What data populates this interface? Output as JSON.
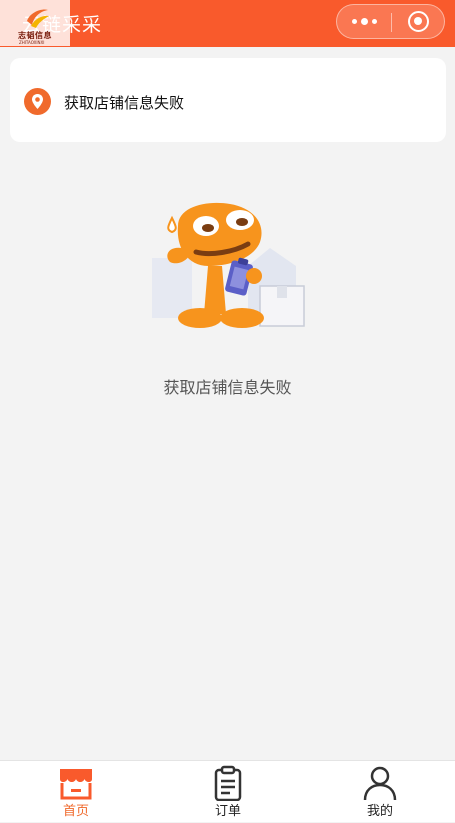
{
  "header": {
    "title": "云链采采",
    "logo_cn": "志韬信息",
    "logo_en": "ZHITAOXINXI",
    "more_icon": "more-dots-icon",
    "close_icon": "target-close-icon"
  },
  "store": {
    "icon": "location-pin-icon",
    "status_text": "获取店铺信息失败"
  },
  "empty_state": {
    "illustration": "mascot-clipboard-illustration",
    "message": "获取店铺信息失败"
  },
  "tabbar": {
    "tabs": [
      {
        "label": "首页",
        "icon": "storefront-icon",
        "active": true
      },
      {
        "label": "订单",
        "icon": "clipboard-list-icon",
        "active": false
      },
      {
        "label": "我的",
        "icon": "user-profile-icon",
        "active": false
      }
    ]
  },
  "colors": {
    "brand": "#f95a2c",
    "accent": "#f06a2c",
    "background": "#f3f3f3",
    "mascot": "#f7941d"
  }
}
